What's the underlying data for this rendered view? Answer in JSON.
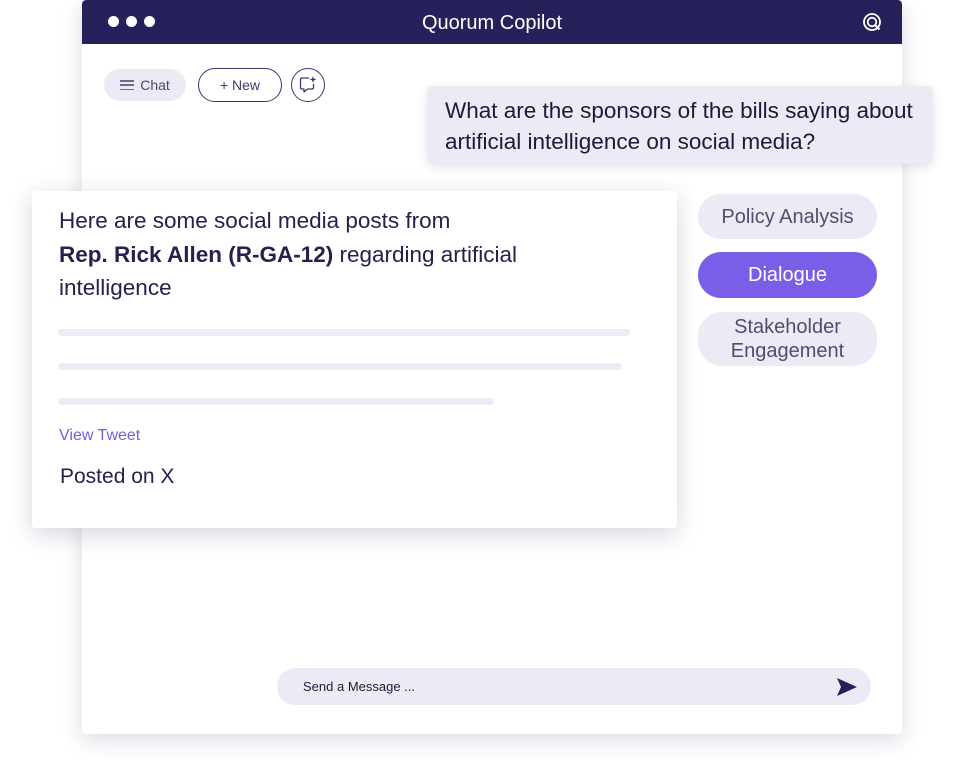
{
  "window": {
    "title": "Quorum Copilot"
  },
  "toolbar": {
    "chat_label": "Chat",
    "new_label": "+ New"
  },
  "user_message": "What are the sponsors of the bills saying about artificial intelligence on social media?",
  "response": {
    "intro": "Here are some social media posts from",
    "name": "Rep. Rick Allen (R-GA-12)",
    "outro": " regarding artificial intelligence",
    "link": "View Tweet",
    "source": "Posted on X"
  },
  "chips": [
    {
      "label": "Policy Analysis"
    },
    {
      "label": "Dialogue"
    },
    {
      "label": "Stakeholder Engagement"
    }
  ],
  "composer": {
    "placeholder": "Send a Message ..."
  },
  "icons": {
    "menu": "menu-icon",
    "spark": "chat-sparkle-icon",
    "logo": "quorum-logo-icon",
    "send": "send-icon"
  },
  "colors": {
    "titlebar": "#25225b",
    "accent": "#7a5ee8",
    "pill_bg": "#ecebf5",
    "link": "#6d63d9"
  }
}
